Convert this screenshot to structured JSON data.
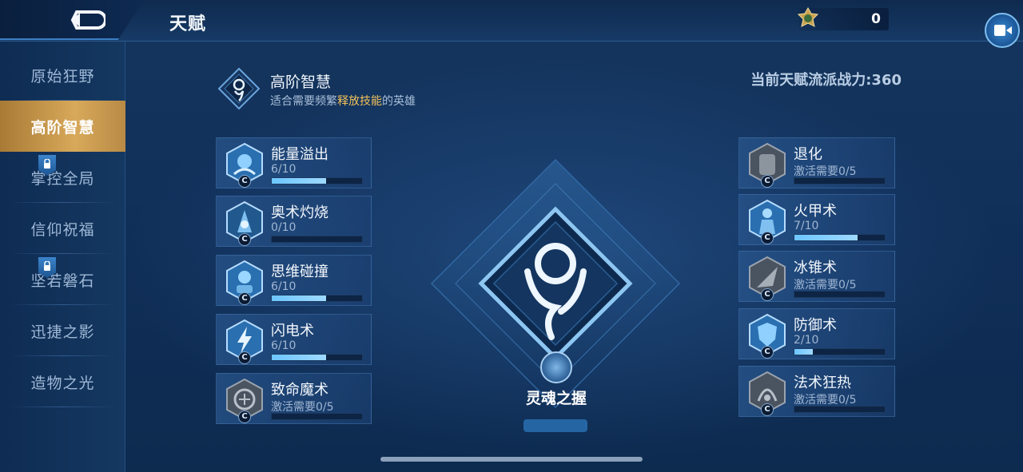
{
  "header": {
    "title": "天赋",
    "currency_value": "0",
    "back_icon": "back-arrow-icon",
    "currency_icon": "medal-icon",
    "video_icon": "video-camera-icon"
  },
  "sidebar": {
    "items": [
      {
        "label": "原始狂野",
        "active": false,
        "locked": false
      },
      {
        "label": "高阶智慧",
        "active": true,
        "locked": false
      },
      {
        "label": "掌控全局",
        "active": false,
        "locked": true
      },
      {
        "label": "信仰祝福",
        "active": false,
        "locked": false
      },
      {
        "label": "坚若磐石",
        "active": false,
        "locked": true
      },
      {
        "label": "迅捷之影",
        "active": false,
        "locked": false
      },
      {
        "label": "造物之光",
        "active": false,
        "locked": false
      }
    ]
  },
  "school": {
    "name": "高阶智慧",
    "desc_pre": "适合需要频繁",
    "desc_highlight": "释放技能",
    "desc_post": "的英雄",
    "power": "当前天赋流派战力:360"
  },
  "talents_left": [
    {
      "name": "能量溢出",
      "level": "6/10",
      "progress": 0.6,
      "badge": "C"
    },
    {
      "name": "奥术灼烧",
      "level": "0/10",
      "progress": 0.0,
      "badge": "C"
    },
    {
      "name": "思维碰撞",
      "level": "6/10",
      "progress": 0.6,
      "badge": "C"
    },
    {
      "name": "闪电术",
      "level": "6/10",
      "progress": 0.6,
      "badge": "C"
    },
    {
      "name": "致命魔术",
      "level": "激活需要0/5",
      "progress": 0.0,
      "badge": "C"
    }
  ],
  "talents_right": [
    {
      "name": "退化",
      "level": "激活需要0/5",
      "progress": 0.0,
      "badge": "C"
    },
    {
      "name": "火甲术",
      "level": "7/10",
      "progress": 0.7,
      "badge": "C"
    },
    {
      "name": "冰锥术",
      "level": "激活需要0/5",
      "progress": 0.0,
      "badge": "C"
    },
    {
      "name": "防御术",
      "level": "2/10",
      "progress": 0.2,
      "badge": "C"
    },
    {
      "name": "法术狂热",
      "level": "激活需要0/5",
      "progress": 0.0,
      "badge": "C"
    }
  ],
  "center": {
    "label": "灵魂之握",
    "emblem_icon": "wisdom-emblem-icon"
  },
  "colors": {
    "accent_gold": "#d8a95a",
    "highlight_text": "#f2c15a",
    "progress_fill": "#6cc6ff"
  }
}
